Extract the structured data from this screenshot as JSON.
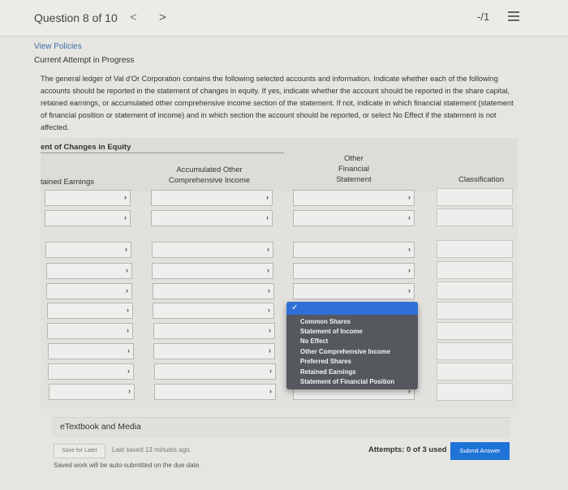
{
  "header": {
    "question_label": "Question 8 of 10",
    "prev_glyph": "<",
    "next_glyph": ">",
    "score": "-/1"
  },
  "meta": {
    "view_policies": "View Policies",
    "status": "Current Attempt in Progress"
  },
  "prompt": "The general ledger of Val d'Or Corporation contains the following selected accounts and information. Indicate whether each of the following accounts should be reported in the statement of changes in equity. If yes, indicate whether the account should be reported in the share capital, retained earnings, or accumulated other comprehensive income section of the statement. If not, indicate in which financial statement (statement of financial position or statement of income) and in which section the account should be reported, or select No Effect if the statement is not affected.",
  "table": {
    "title": "ent of Changes in Equity",
    "headers": {
      "retained_earnings": "tained Earnings",
      "aoci_line1": "Accumulated Other",
      "aoci_line2": "Comprehensive Income",
      "ofs_line1": "Other",
      "ofs_line2": "Financial",
      "ofs_line3": "Statement",
      "classification": "Classification"
    },
    "chevron": "›"
  },
  "dropdown": {
    "check": "✓",
    "options": [
      "Common Shares",
      "Statement of Income",
      "No Effect",
      "Other Comprehensive Income",
      "Preferred Shares",
      "Retained Earnings",
      "Statement of Financial Position"
    ]
  },
  "footer": {
    "etextbook": "eTextbook and Media",
    "save_later": "Save for Later",
    "last_saved": "Last saved 13 minutes ago.",
    "autosubmit": "Saved work will be auto-submitted on the due date.",
    "attempts": "Attempts: 0 of 3 used",
    "submit": "Submit Answer"
  },
  "colors": {
    "accent": "#1f73d6",
    "dropdown_bg": "#55585d",
    "dropdown_selected": "#2f70d8"
  }
}
